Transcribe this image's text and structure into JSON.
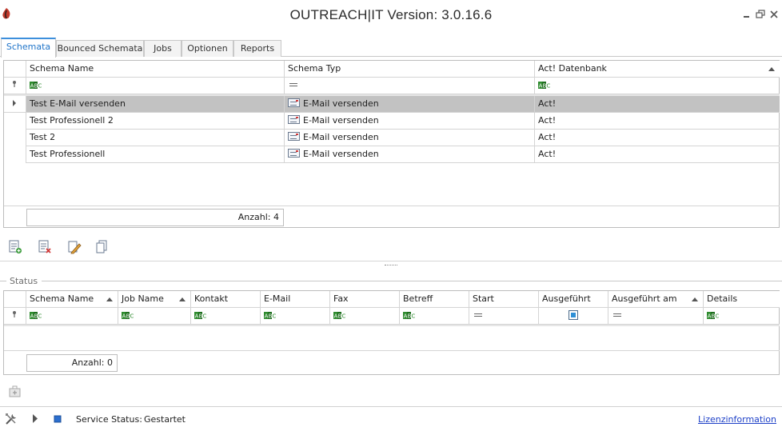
{
  "window": {
    "title": "OUTREACH|IT Version: 3.0.16.6"
  },
  "tabs": [
    {
      "label": "Schemata"
    },
    {
      "label": "Bounced Schemata"
    },
    {
      "label": "Jobs"
    },
    {
      "label": "Optionen"
    },
    {
      "label": "Reports"
    }
  ],
  "schemata_grid": {
    "columns": [
      "Schema Name",
      "Schema Typ",
      "Act! Datenbank"
    ],
    "rows": [
      {
        "name": "Test E-Mail versenden",
        "type": "E-Mail versenden",
        "db": "Act!"
      },
      {
        "name": "Test Professionell 2",
        "type": "E-Mail versenden",
        "db": "Act!"
      },
      {
        "name": "Test 2",
        "type": "E-Mail versenden",
        "db": "Act!"
      },
      {
        "name": "Test Professionell",
        "type": "E-Mail versenden",
        "db": "Act!"
      }
    ],
    "count_label": "Anzahl: 4"
  },
  "status_section": {
    "legend": "Status",
    "columns": [
      "Schema Name",
      "Job Name",
      "Kontakt",
      "E-Mail",
      "Fax",
      "Betreff",
      "Start",
      "Ausgeführt",
      "Ausgeführt am",
      "Details"
    ],
    "count_label": "Anzahl: 0"
  },
  "statusbar": {
    "service_status_label": "Service Status:",
    "service_status_value": "Gestartet",
    "license_link": "Lizenzinformation"
  },
  "colors": {
    "accent": "#1f74c9",
    "selected_row": "#c2c2c2",
    "link": "#1c3fc7"
  }
}
